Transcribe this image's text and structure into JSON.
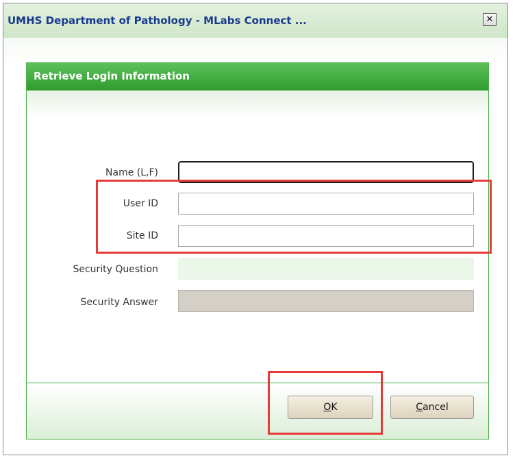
{
  "window": {
    "title": "UMHS Department of Pathology - MLabs Connect ...",
    "close_glyph": "✕"
  },
  "panel": {
    "title": "Retrieve Login Information"
  },
  "form": {
    "name_label": "Name (L,F)",
    "name_value": "",
    "user_id_label": "User ID",
    "user_id_value": "",
    "site_id_label": "Site ID",
    "site_id_value": "",
    "security_question_label": "Security Question",
    "security_question_value": "",
    "security_answer_label": "Security Answer",
    "security_answer_value": ""
  },
  "buttons": {
    "ok_mnemonic": "O",
    "ok_rest": "K",
    "cancel_mnemonic": "C",
    "cancel_rest": "ancel"
  },
  "colors": {
    "header_green": "#2f9c2e",
    "highlight_red": "#e83a3a",
    "answer_disabled": "#d4d0c8"
  }
}
